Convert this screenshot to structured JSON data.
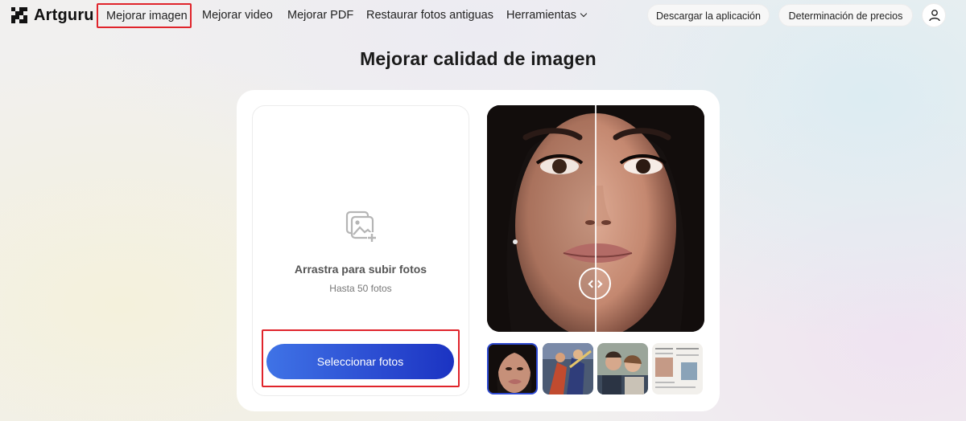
{
  "nav": {
    "brand": "Artguru",
    "links": [
      "Mejorar imagen",
      "Mejorar video",
      "Mejorar PDF",
      "Restaurar fotos antiguas",
      "Herramientas"
    ],
    "download_label": "Descargar la aplicación",
    "pricing_label": "Determinación de precios"
  },
  "main": {
    "title": "Mejorar calidad de imagen",
    "upload": {
      "title": "Arrastra para subir fotos",
      "subtitle": "Hasta 50 fotos",
      "button_label": "Seleccionar fotos"
    },
    "thumbnails": [
      "portrait-woman",
      "action-characters",
      "family-couple",
      "document-photos"
    ]
  },
  "colors": {
    "accent_blue": "#2d4fd3",
    "highlight_red": "#e0242b"
  }
}
